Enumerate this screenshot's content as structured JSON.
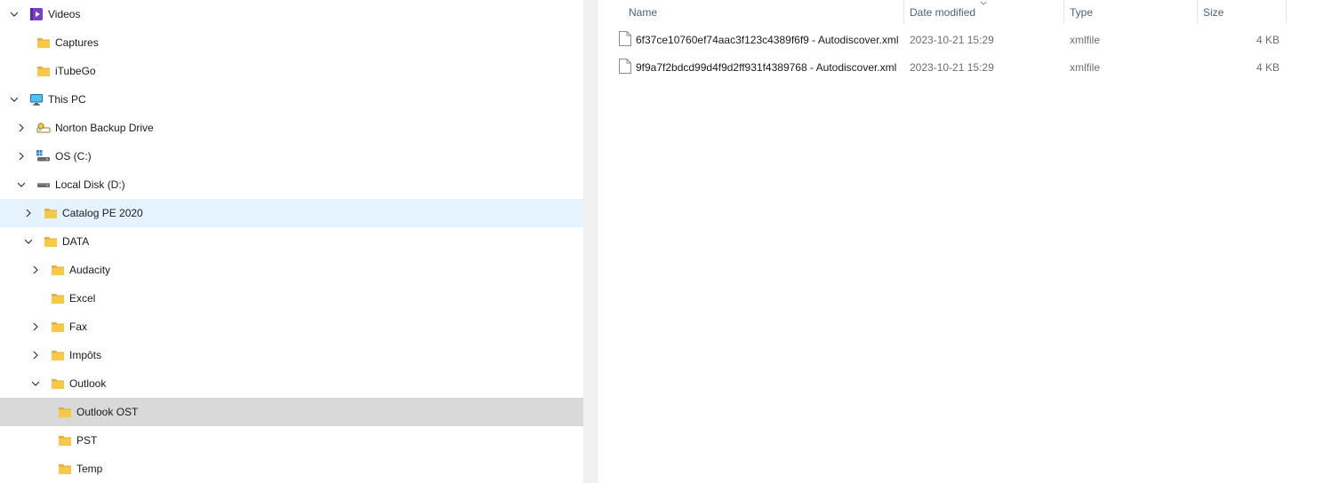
{
  "nav": {
    "items": [
      {
        "label": "Videos",
        "icon": "videos-library-icon",
        "expanded": true
      },
      {
        "label": "Captures",
        "icon": "folder-icon"
      },
      {
        "label": "iTubeGo",
        "icon": "folder-icon"
      },
      {
        "label": "This PC",
        "icon": "this-pc-icon",
        "expanded": true
      },
      {
        "label": "Norton Backup Drive",
        "icon": "cloud-drive-icon",
        "expanded": false
      },
      {
        "label": "OS (C:)",
        "icon": "system-drive-icon",
        "expanded": false
      },
      {
        "label": "Local Disk (D:)",
        "icon": "local-disk-icon",
        "expanded": true
      },
      {
        "label": "Catalog PE 2020",
        "icon": "folder-icon",
        "expanded": false,
        "state": "hover"
      },
      {
        "label": "DATA",
        "icon": "folder-icon",
        "expanded": true
      },
      {
        "label": "Audacity",
        "icon": "folder-icon",
        "expanded": false
      },
      {
        "label": "Excel",
        "icon": "folder-icon"
      },
      {
        "label": "Fax",
        "icon": "folder-icon",
        "expanded": false
      },
      {
        "label": "Impôts",
        "icon": "folder-icon",
        "expanded": false
      },
      {
        "label": "Outlook",
        "icon": "folder-icon",
        "expanded": true
      },
      {
        "label": "Outlook OST",
        "icon": "folder-icon",
        "state": "selected"
      },
      {
        "label": "PST",
        "icon": "folder-icon"
      },
      {
        "label": "Temp",
        "icon": "folder-icon"
      }
    ]
  },
  "list": {
    "columns": {
      "name": "Name",
      "date": "Date modified",
      "type": "Type",
      "size": "Size"
    },
    "sort_column": "Date modified",
    "files": [
      {
        "name": "6f37ce10760ef74aac3f123c4389f6f9 - Autodiscover.xml",
        "date": "2023-10-21 15:29",
        "type": "xmlfile",
        "size": "4 KB"
      },
      {
        "name": "9f9a7f2bdcd99d4f9d2ff931f4389768 - Autodiscover.xml",
        "date": "2023-10-21 15:29",
        "type": "xmlfile",
        "size": "4 KB"
      }
    ]
  },
  "colors": {
    "hover": "#e5f3ff",
    "selected": "#d9d9d9",
    "folder": "#f8c948",
    "header_text": "#4c607a"
  }
}
